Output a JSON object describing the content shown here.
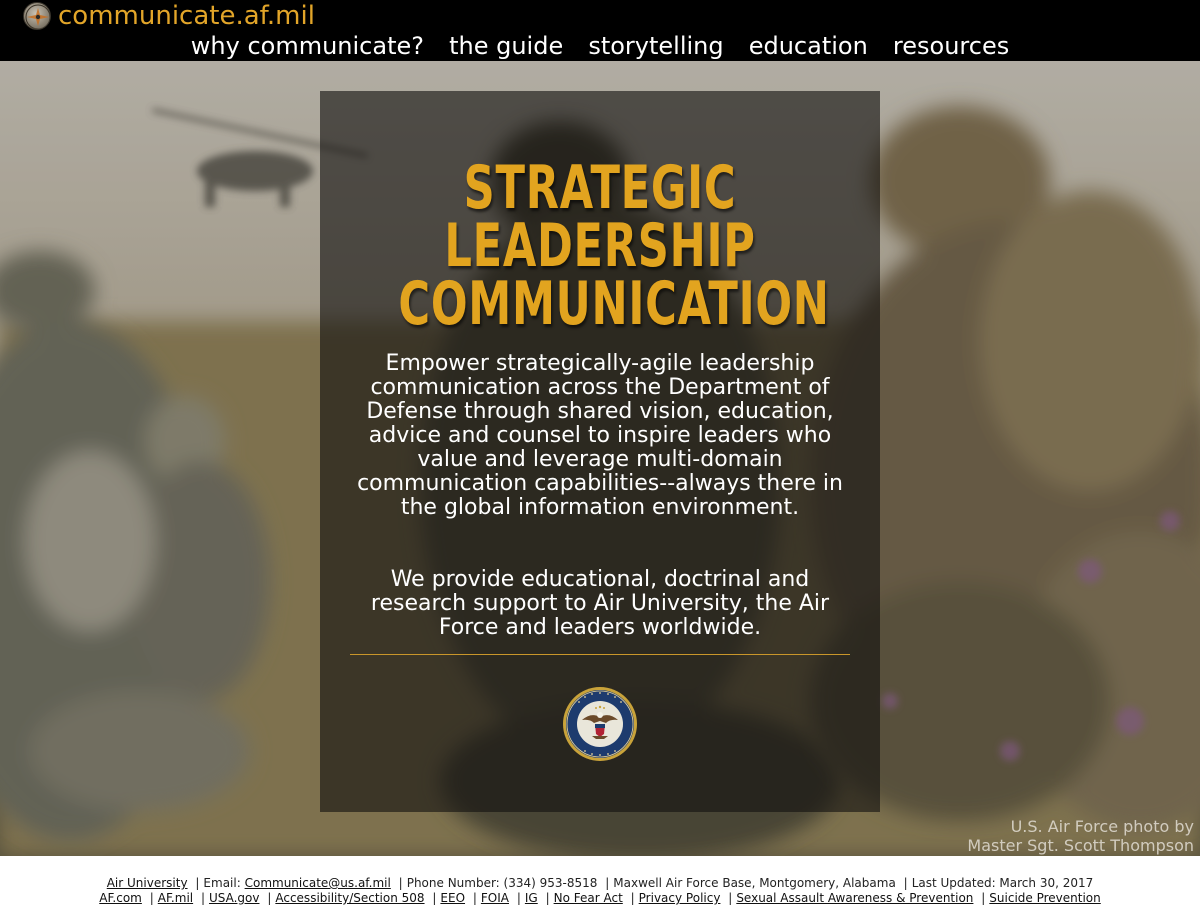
{
  "header": {
    "site_title": "communicate.af.mil",
    "logo_icon": "air-force-emblem-icon"
  },
  "nav": {
    "items": [
      {
        "label": "why communicate?"
      },
      {
        "label": "the guide"
      },
      {
        "label": "storytelling"
      },
      {
        "label": "education"
      },
      {
        "label": "resources"
      }
    ]
  },
  "hero": {
    "title_lines": [
      "STRATEGIC",
      "LEADERSHIP",
      "COMMUNICATION"
    ],
    "mission": "Empower strategically-agile leadership communication across the Department of Defense through shared vision, education, advice and counsel to inspire leaders who value and leverage multi-domain communication capabilities--always there in the global information environment.",
    "support": "We provide educational, doctrinal and research support to Air University, the Air Force and leaders worldwide.",
    "seal_icon": "department-of-defense-seal-icon",
    "seal_text": "DEPARTMENT OF DEFENSE · UNITED STATES OF AMERICA",
    "photo_credit_line1": "U.S. Air Force photo by",
    "photo_credit_line2": "Master Sgt. Scott Thompson"
  },
  "footer": {
    "org_link": "Air University",
    "email_label": "Email:",
    "email_link": "Communicate@us.af.mil",
    "phone": "Phone Number: (334) 953-8518",
    "location": "Maxwell Air Force Base, Montgomery, Alabama",
    "updated": "Last Updated: March 30, 2017",
    "links": [
      "AF.com",
      "AF.mil",
      "USA.gov",
      "Accessibility/Section 508",
      "EEO",
      "FOIA",
      "IG",
      "No Fear Act",
      "Privacy Policy",
      "Sexual Assault Awareness & Prevention",
      "Suicide Prevention"
    ]
  },
  "colors": {
    "accent_gold": "#e2a529",
    "topbar": "#000000",
    "panel": "rgba(20,18,16,0.62)"
  }
}
